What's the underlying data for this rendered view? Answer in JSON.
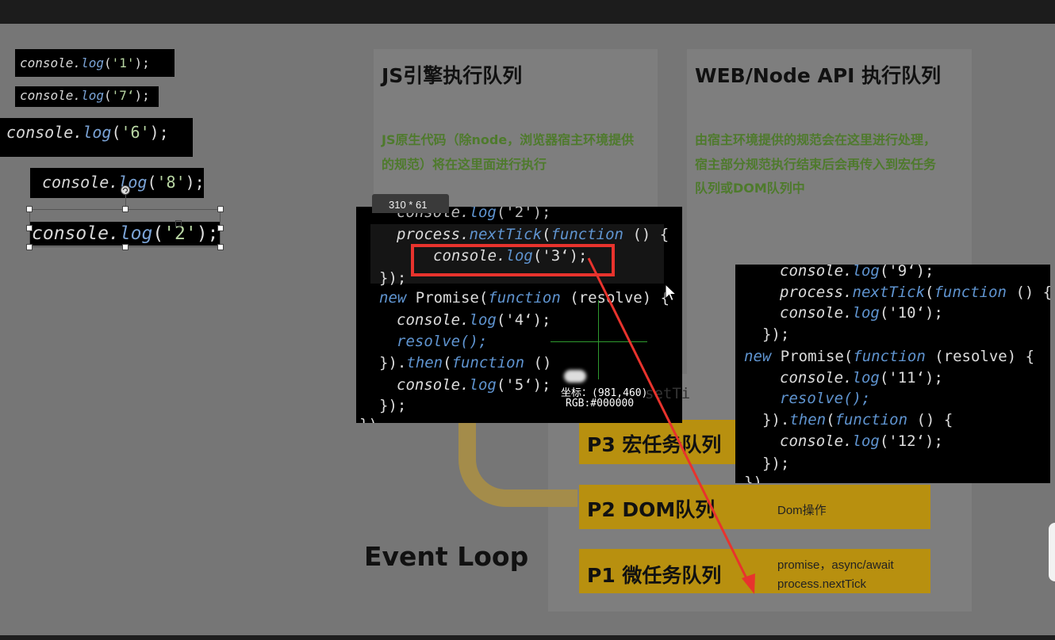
{
  "chips": [
    {
      "obj": "console.",
      "fn": "log",
      "open": "(",
      "str": "'1'",
      "close": ");"
    },
    {
      "obj": "console.",
      "fn": "log",
      "open": "(",
      "str": "'7‘",
      "close": ");"
    },
    {
      "obj": "console.",
      "fn": "log",
      "open": "(",
      "str": "'6'",
      "close": ");"
    },
    {
      "obj": "console.",
      "fn": "log",
      "open": "(",
      "str": "'8'",
      "close": ");"
    },
    {
      "obj": "console.",
      "fn": "log",
      "open": "(",
      "str": "'2'",
      "close": ");"
    }
  ],
  "panels": {
    "js_engine": {
      "title": "JS引擎执行队列",
      "desc1": "JS原生代码（除node，浏览器宿主环境提供",
      "desc2": "的规范）将在这里面进行执行"
    },
    "web_api": {
      "title": "WEB/Node API 执行队列",
      "desc1": "由宿主环境提供的规范会在这里进行处理，",
      "desc2": "宿主部分规范执行结束后会再传入到宏任务",
      "desc3": "队列或DOM队列中"
    }
  },
  "code1": {
    "l1a": "console.",
    "l1b": "log",
    "l1c": "('2');",
    "l2a": "process.",
    "l2b": "nextTick",
    "l2c": "(",
    "l2d": "function",
    "l2e": " () {",
    "l3a": "console.",
    "l3b": "log",
    "l3c": "('3‘);",
    "l4": "});",
    "l5a": "new ",
    "l5b": "Promise(",
    "l5c": "function",
    "l5d": " (resolve) {",
    "l6a": "console.",
    "l6b": "log",
    "l6c": "('4‘);",
    "l7": "resolve();",
    "l8a": "}).",
    "l8b": "then",
    "l8c": "(",
    "l8d": "function",
    "l8e": " ()",
    "l9a": "console.",
    "l9b": "log",
    "l9c": "('5‘);",
    "l10": "});",
    "l11": "})"
  },
  "code2": {
    "l1a": "console.",
    "l1b": "log",
    "l1c": "('9‘);",
    "l2a": "process.",
    "l2b": "nextTick",
    "l2c": "(",
    "l2d": "function",
    "l2e": " () {",
    "l3a": "console.",
    "l3b": "log",
    "l3c": "('10‘);",
    "l4": "});",
    "l5a": "new ",
    "l5b": "Promise(",
    "l5c": "function",
    "l5d": " (resolve) {",
    "l6a": "console.",
    "l6b": "log",
    "l6c": "('11‘);",
    "l7": "resolve();",
    "l8a": "}).",
    "l8b": "then",
    "l8c": "(",
    "l8d": "function",
    "l8e": " () {",
    "l9a": "console.",
    "l9b": "log",
    "l9c": "('12‘);",
    "l10": "});",
    "l11": "})"
  },
  "overlay": {
    "size_badge": "310 * 61",
    "coords": "坐标：(981,460)",
    "rgb": "RGB:#000000",
    "partial_settimeout": "setTi"
  },
  "queues": {
    "p3": {
      "label": "P3 宏任务队列"
    },
    "p2": {
      "label": "P2 DOM队列",
      "note": "Dom操作"
    },
    "p1": {
      "label": "P1 微任务队列",
      "note1": "promise，async/await",
      "note2": "process.nextTick"
    }
  },
  "event_loop": "Event Loop",
  "colors": {
    "queue": "#b8900f",
    "highlight": "#e8332d",
    "arrow": "#e8332d",
    "desc_green": "#4e7a2c"
  }
}
